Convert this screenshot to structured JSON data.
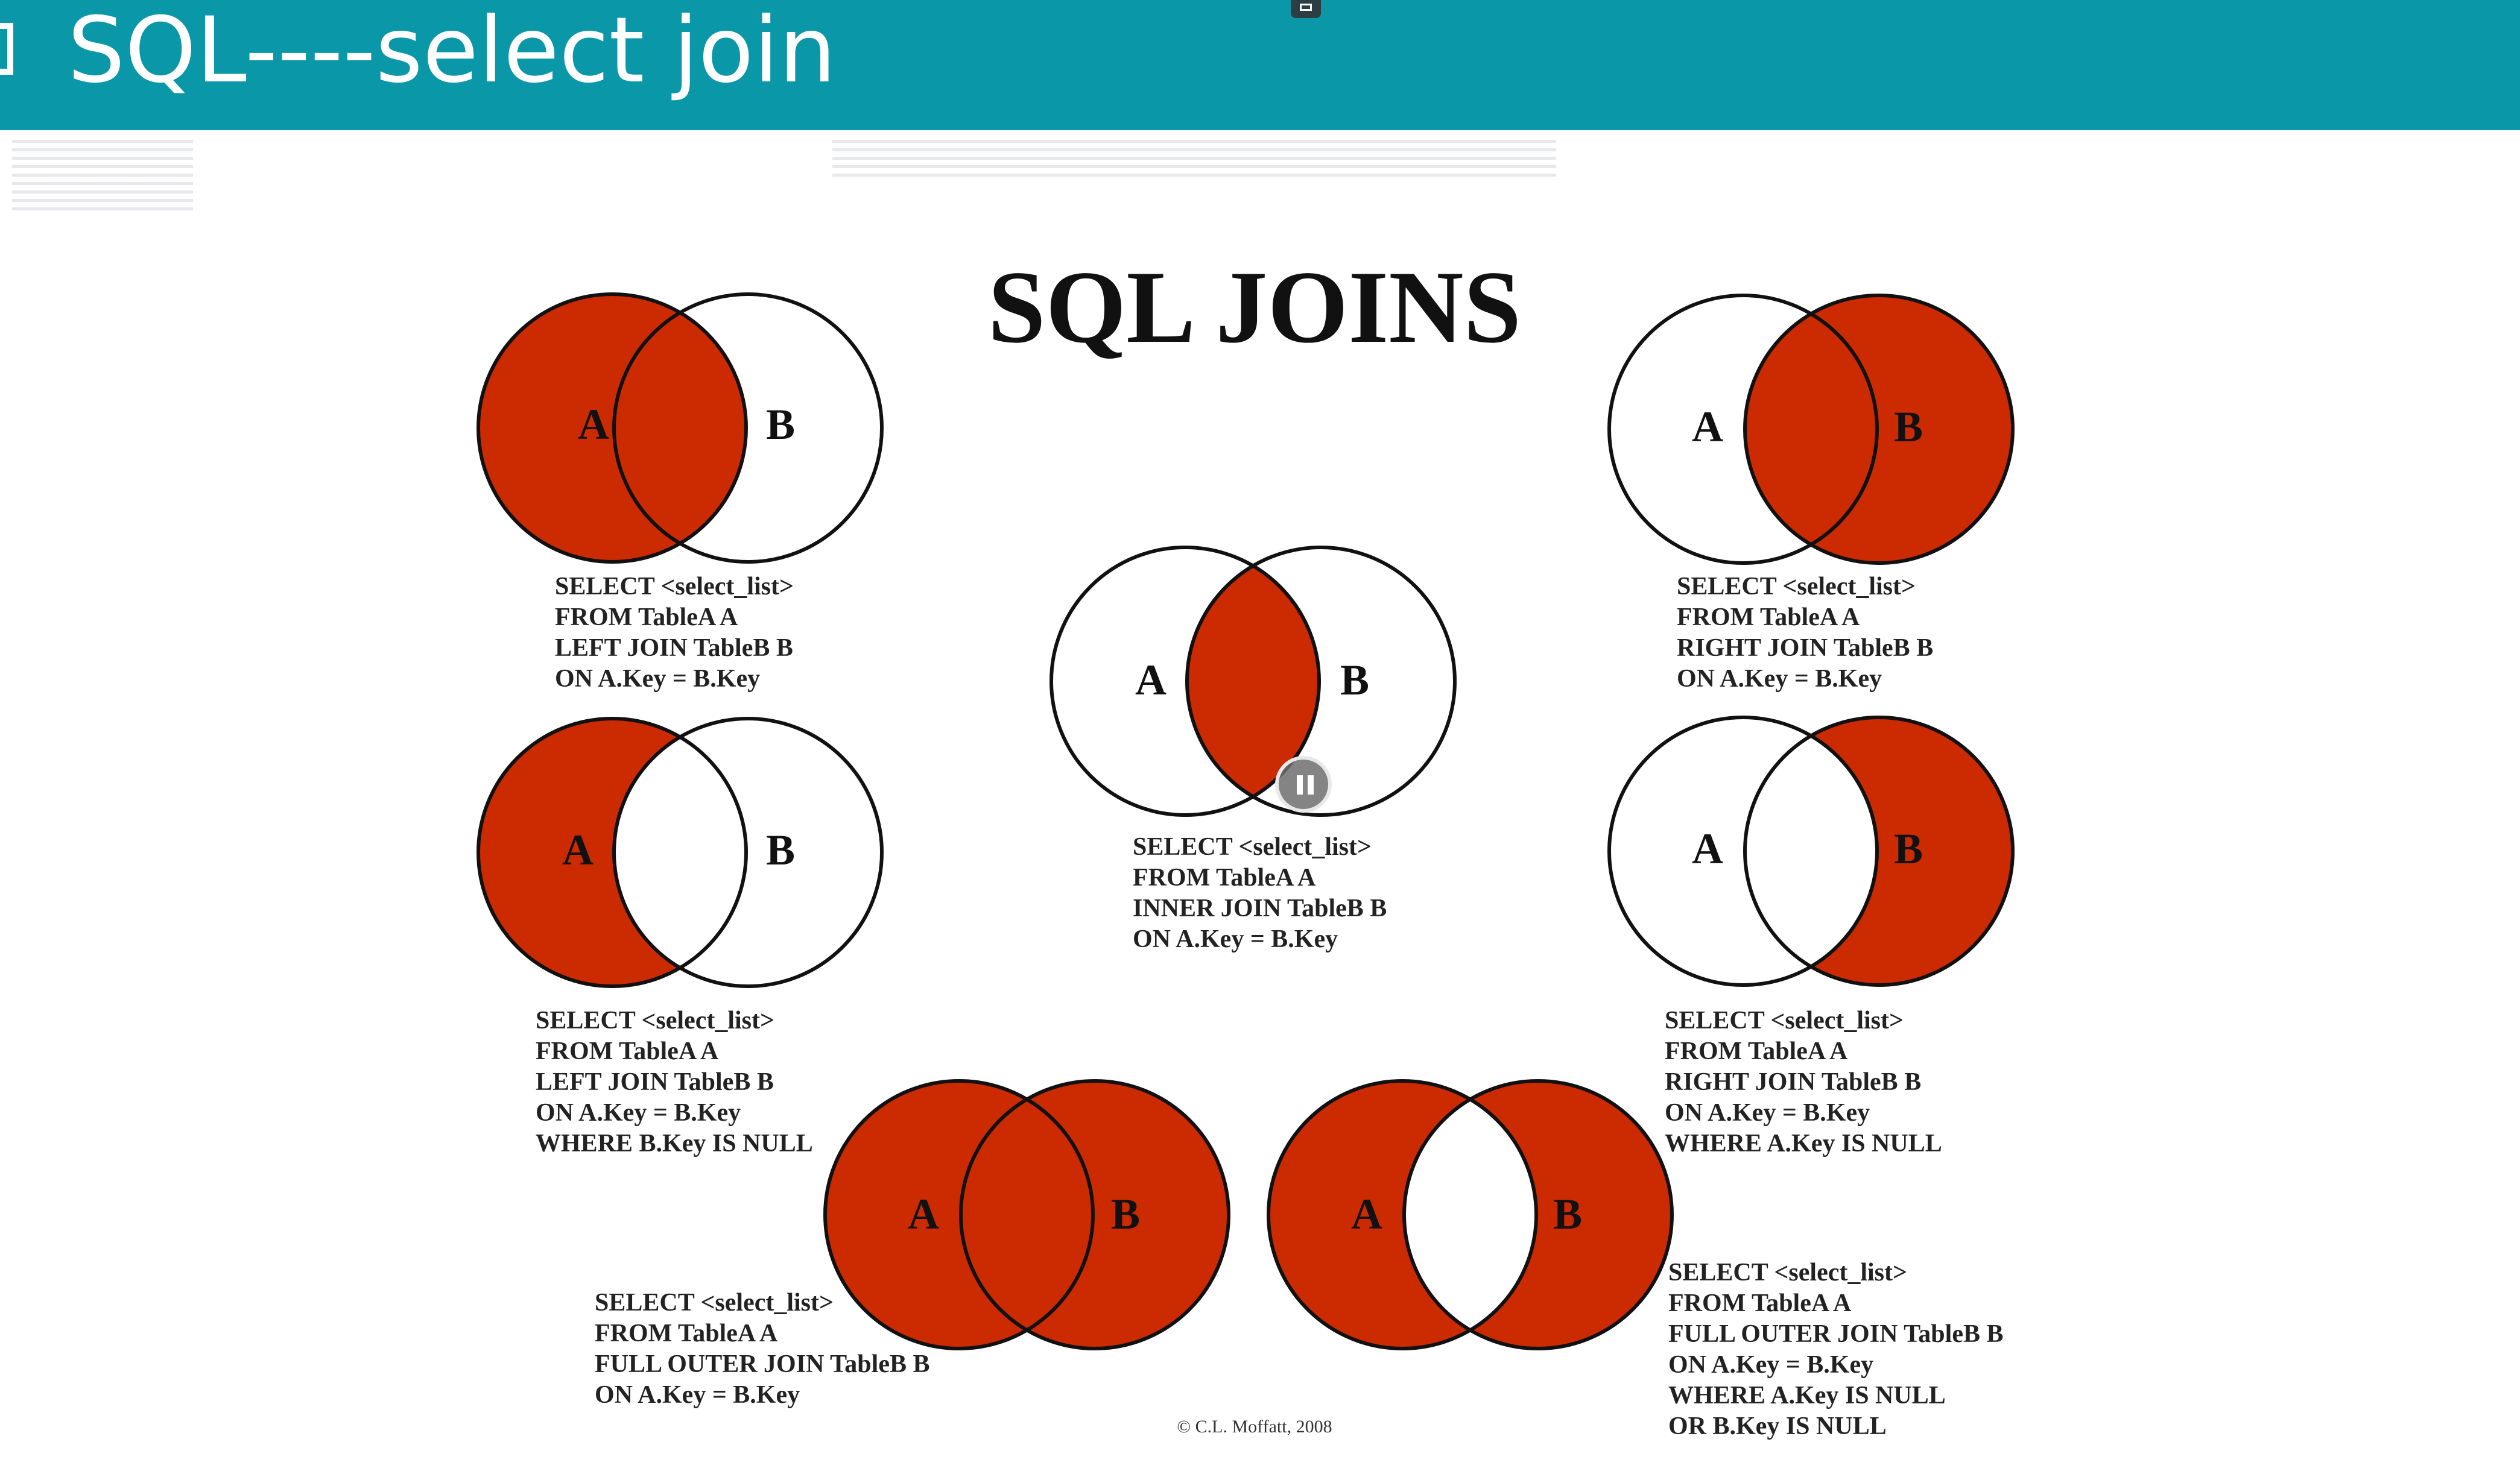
{
  "header": {
    "title": "SQL----select join"
  },
  "diagram": {
    "title": "SQL JOINS",
    "copyright": "© C.L. Moffatt, 2008",
    "fill_color": "#cc2a00",
    "label_a": "A",
    "label_b": "B",
    "panels": [
      {
        "id": "left-join",
        "fill": "a-all",
        "code": [
          "SELECT <select_list>",
          "FROM TableA A",
          "LEFT JOIN TableB B",
          "ON A.Key = B.Key"
        ]
      },
      {
        "id": "right-join",
        "fill": "b-all",
        "code": [
          "SELECT <select_list>",
          "FROM TableA A",
          "RIGHT JOIN TableB B",
          "ON A.Key = B.Key"
        ]
      },
      {
        "id": "inner-join",
        "fill": "intersection",
        "code": [
          "SELECT <select_list>",
          "FROM TableA A",
          "INNER JOIN TableB B",
          "ON A.Key = B.Key"
        ]
      },
      {
        "id": "left-excluding-join",
        "fill": "a-only",
        "code": [
          "SELECT <select_list>",
          "FROM TableA A",
          "LEFT JOIN TableB B",
          "ON A.Key = B.Key",
          "WHERE B.Key IS NULL"
        ]
      },
      {
        "id": "right-excluding-join",
        "fill": "b-only",
        "code": [
          "SELECT <select_list>",
          "FROM TableA A",
          "RIGHT JOIN TableB B",
          "ON A.Key = B.Key",
          "WHERE A.Key IS NULL"
        ]
      },
      {
        "id": "full-outer-join",
        "fill": "union",
        "code": [
          "SELECT <select_list>",
          "FROM TableA A",
          "FULL OUTER JOIN TableB B",
          "ON A.Key = B.Key"
        ]
      },
      {
        "id": "full-outer-excluding-join",
        "fill": "symmetric-difference",
        "code": [
          "SELECT <select_list>",
          "FROM TableA A",
          "FULL OUTER JOIN TableB B",
          "ON A.Key = B.Key",
          "WHERE A.Key IS NULL",
          "OR B.Key IS NULL"
        ]
      }
    ]
  },
  "video": {
    "pause_icon": "pause-icon"
  }
}
